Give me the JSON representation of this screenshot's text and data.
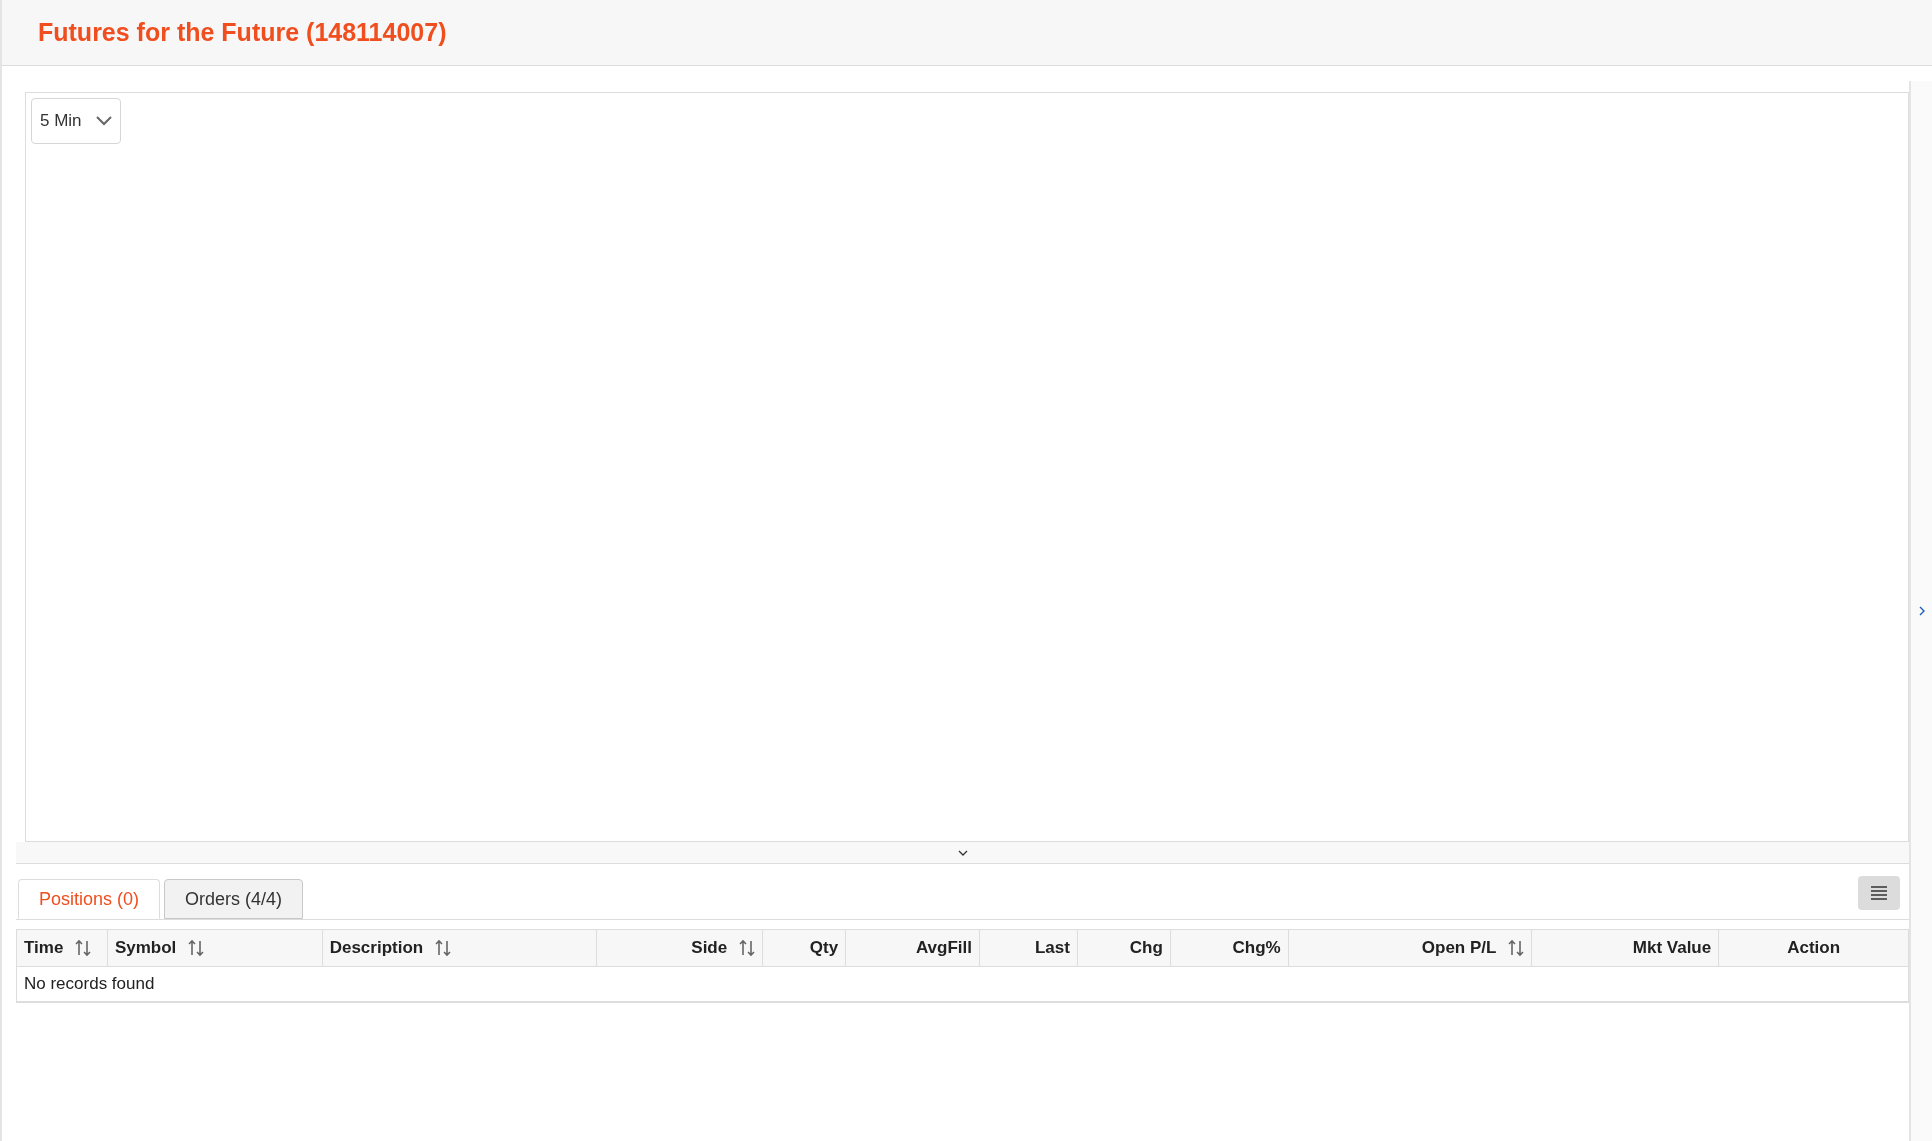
{
  "header": {
    "title": "Futures for the Future (148114007)"
  },
  "chart_panel": {
    "interval": {
      "value": "5 Min"
    }
  },
  "tabs": [
    {
      "label": "Positions (0)",
      "selected": true
    },
    {
      "label": "Orders (4/4)",
      "selected": false
    }
  ],
  "table": {
    "columns": [
      {
        "label": "Time",
        "sortable": true
      },
      {
        "label": "Symbol",
        "sortable": true
      },
      {
        "label": "Description",
        "sortable": true
      },
      {
        "label": "Side",
        "sortable": true
      },
      {
        "label": "Qty",
        "sortable": false
      },
      {
        "label": "AvgFill",
        "sortable": false
      },
      {
        "label": "Last",
        "sortable": false
      },
      {
        "label": "Chg",
        "sortable": false
      },
      {
        "label": "Chg%",
        "sortable": false
      },
      {
        "label": "Open P/L",
        "sortable": true
      },
      {
        "label": "Mkt Value",
        "sortable": false
      },
      {
        "label": "Action",
        "sortable": false
      }
    ],
    "empty_message": "No records found"
  }
}
